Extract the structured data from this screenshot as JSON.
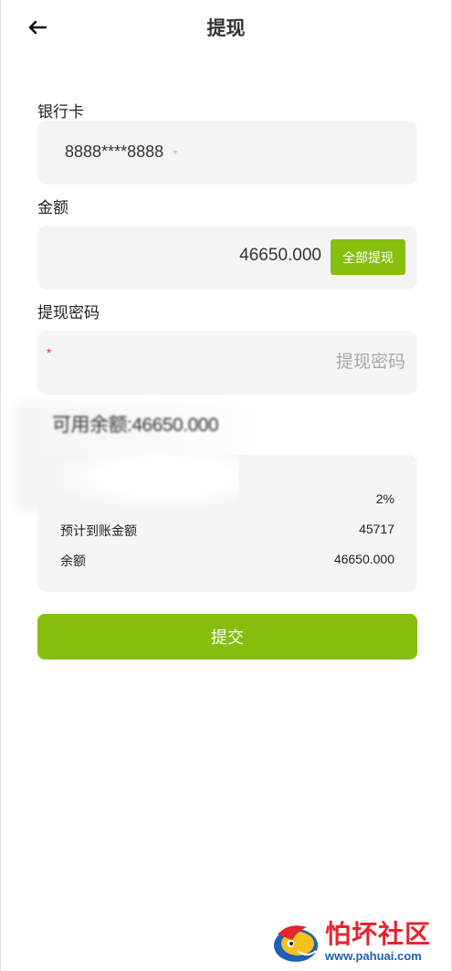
{
  "header": {
    "title": "提现",
    "back_icon": "arrow-left-icon"
  },
  "bank_card": {
    "label": "银行卡",
    "value": "8888****8888"
  },
  "amount": {
    "label": "金额",
    "value": "46650.000",
    "all_button": "全部提现"
  },
  "password": {
    "label": "提现密码",
    "required_mark": "*",
    "placeholder": "提现密码",
    "value": ""
  },
  "available": {
    "text": "可用余额:46650.000"
  },
  "summary": {
    "fee_rate": "2%",
    "rows": [
      {
        "label": "预计到账金额",
        "value": "45717"
      },
      {
        "label": "余额",
        "value": "46650.000"
      }
    ]
  },
  "submit_label": "提交",
  "watermark": {
    "main": "怕坏社区",
    "url": "www.pahuai.com"
  },
  "colors": {
    "accent": "#86bf0e",
    "field_bg": "#f5f5f5",
    "required": "#e23c3c",
    "watermark_red": "#e8232f",
    "watermark_blue": "#1f5fb4"
  }
}
